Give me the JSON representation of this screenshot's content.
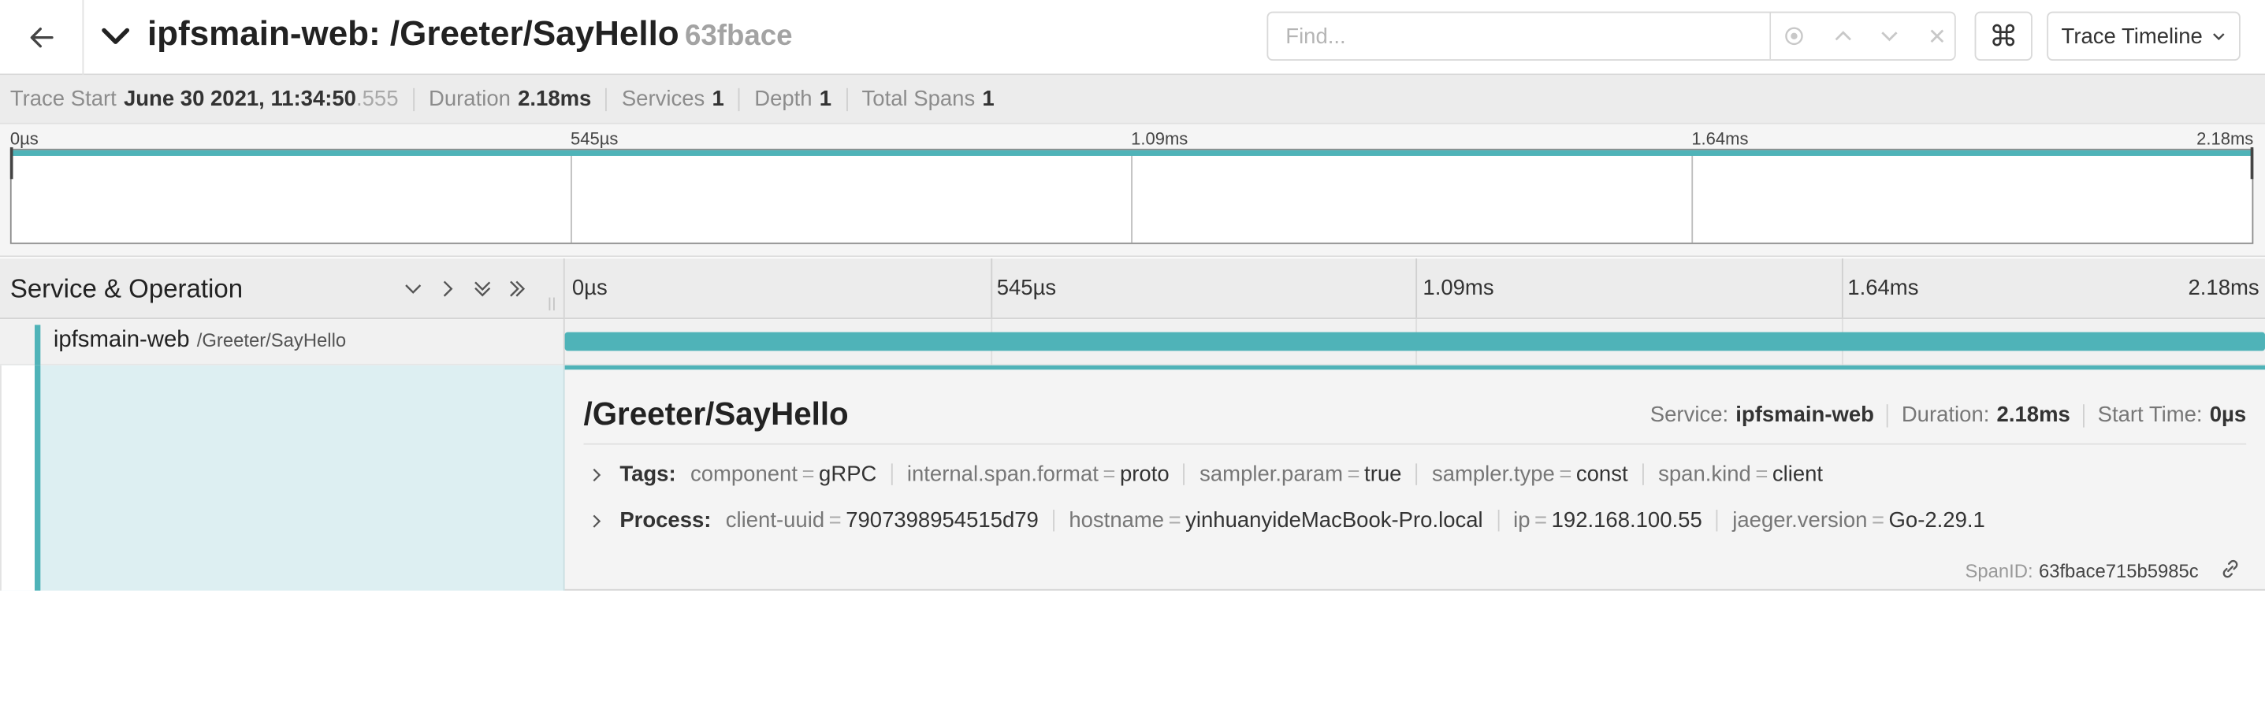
{
  "header": {
    "title": "ipfsmain-web: /Greeter/SayHello",
    "trace_id": "63fbace",
    "find_placeholder": "Find...",
    "view_select": "Trace Timeline",
    "keyboard_shortcut_glyph": "⌘"
  },
  "trace_info": {
    "start_label": "Trace Start",
    "start_value": "June 30 2021, 11:34:50",
    "start_ms": ".555",
    "duration_label": "Duration",
    "duration_value": "2.18ms",
    "services_label": "Services",
    "services_value": "1",
    "depth_label": "Depth",
    "depth_value": "1",
    "total_spans_label": "Total Spans",
    "total_spans_value": "1"
  },
  "minimap": {
    "ticks": [
      "0µs",
      "545µs",
      "1.09ms",
      "1.64ms",
      "2.18ms"
    ]
  },
  "timeline": {
    "column_title": "Service & Operation",
    "ticks": [
      "0µs",
      "545µs",
      "1.09ms",
      "1.64ms",
      "2.18ms"
    ]
  },
  "span": {
    "service": "ipfsmain-web",
    "operation": "/Greeter/SayHello",
    "start_fraction": 0,
    "duration_fraction": 1,
    "color": "#4fb3b8"
  },
  "detail": {
    "title": "/Greeter/SayHello",
    "service_label": "Service:",
    "service_value": "ipfsmain-web",
    "duration_label": "Duration:",
    "duration_value": "2.18ms",
    "start_label": "Start Time:",
    "start_value": "0µs",
    "tags_label": "Tags:",
    "tags": [
      {
        "key": "component",
        "value": "gRPC"
      },
      {
        "key": "internal.span.format",
        "value": "proto"
      },
      {
        "key": "sampler.param",
        "value": "true"
      },
      {
        "key": "sampler.type",
        "value": "const"
      },
      {
        "key": "span.kind",
        "value": "client"
      }
    ],
    "process_label": "Process:",
    "process": [
      {
        "key": "client-uuid",
        "value": "7907398954515d79"
      },
      {
        "key": "hostname",
        "value": "yinhuanyideMacBook-Pro.local"
      },
      {
        "key": "ip",
        "value": "192.168.100.55"
      },
      {
        "key": "jaeger.version",
        "value": "Go-2.29.1"
      }
    ],
    "span_id_label": "SpanID:",
    "span_id_value": "63fbace715b5985c"
  }
}
